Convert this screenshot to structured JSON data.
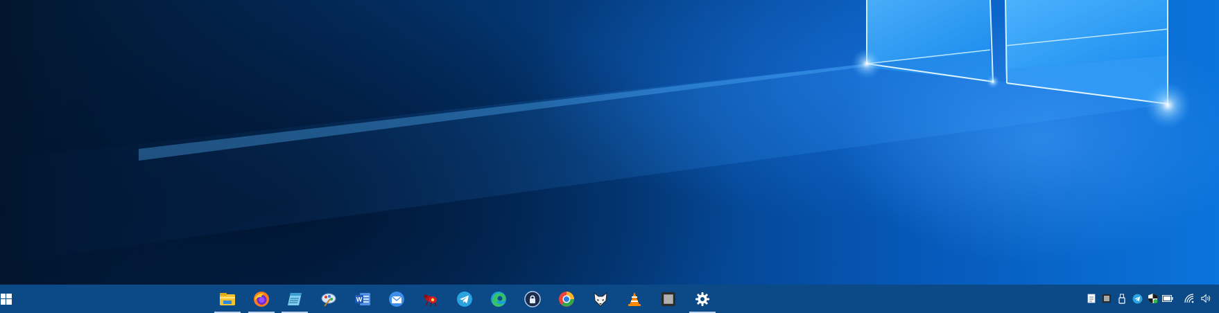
{
  "desktop": {
    "wallpaper": "windows-10-hero-light"
  },
  "taskbar": {
    "background": "#0b4a86",
    "start_icon": "windows-logo-icon",
    "apps": [
      {
        "icon": "file-explorer-icon",
        "running": true
      },
      {
        "icon": "firefox-icon",
        "running": true
      },
      {
        "icon": "notepad-icon",
        "running": true
      },
      {
        "icon": "paint-icon",
        "running": false
      },
      {
        "icon": "word-icon",
        "running": false
      },
      {
        "icon": "mail-icon",
        "running": false
      },
      {
        "icon": "ant-app-icon",
        "running": false
      },
      {
        "icon": "telegram-icon",
        "running": false
      },
      {
        "icon": "edge-icon",
        "running": false
      },
      {
        "icon": "vpn-lock-icon",
        "running": false
      },
      {
        "icon": "chromium-icon",
        "running": false
      },
      {
        "icon": "foobar-fox-icon",
        "running": false
      },
      {
        "icon": "vlc-icon",
        "running": false
      },
      {
        "icon": "blank-app-icon",
        "running": false
      },
      {
        "icon": "settings-gear-icon",
        "running": true
      }
    ]
  },
  "tray": {
    "icons": [
      "document-tray-icon",
      "app-tray-icon",
      "usb-tray-icon",
      "telegram-tray-icon",
      "security-shield-tray-icon",
      "battery-tray-icon",
      "wifi-tray-icon",
      "volume-tray-icon"
    ]
  }
}
